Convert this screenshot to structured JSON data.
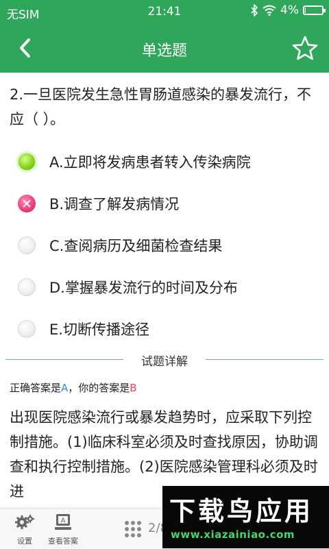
{
  "status_bar": {
    "carrier": "无SIM",
    "time": "21:41",
    "battery": "4%",
    "battery_level": 0.04
  },
  "nav": {
    "title": "单选题"
  },
  "question": {
    "text": "2.一旦医院发生急性胃肠道感染的暴发流行，不应（ ）。"
  },
  "options": [
    {
      "label": "A.立即将发病患者转入传染病院",
      "state": "correct"
    },
    {
      "label": "B.调查了解发病情况",
      "state": "wrong"
    },
    {
      "label": "C.查阅病历及细菌检查结果",
      "state": "normal"
    },
    {
      "label": "D.掌握暴发流行的时间及分布",
      "state": "normal"
    },
    {
      "label": "E.切断传播途径",
      "state": "normal"
    }
  ],
  "detail": {
    "divider_label": "试题详解",
    "correct_prefix": "正确答案是",
    "correct_answer": "A",
    "your_prefix": "，你的答案是",
    "your_answer": "B",
    "explanation": "出现医院感染流行或暴发趋势时，应采取下列控制措施。(1)临床科室必须及时查找原因，协助调查和执行控制措施。(2)医院感染管理科必须及时进"
  },
  "bottom_bar": {
    "settings_label": "设置",
    "view_answer_label": "查看答案",
    "view_answer_icon_text": "A",
    "page": "2/8"
  },
  "watermark": {
    "title": "下载鸟应用",
    "url": "www.xiazainiao.com"
  },
  "colors": {
    "primary": "#2fa75a",
    "correct_letter": "#2e90d8",
    "wrong_letter": "#e8435a"
  }
}
